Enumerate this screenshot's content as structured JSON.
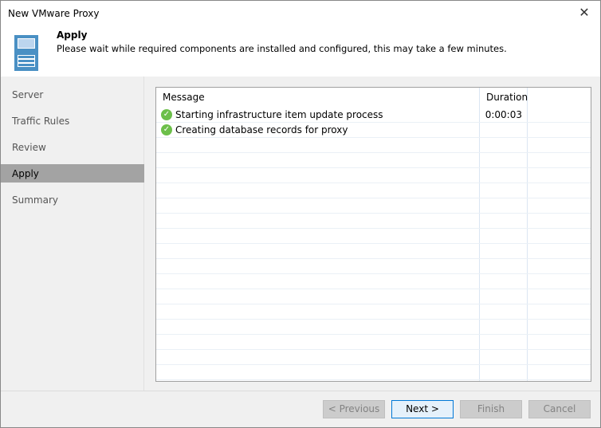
{
  "window": {
    "title": "New VMware Proxy"
  },
  "header": {
    "title": "Apply",
    "description": "Please wait while required components are installed and configured, this may take a few minutes."
  },
  "sidebar": {
    "items": [
      {
        "label": "Server"
      },
      {
        "label": "Traffic Rules"
      },
      {
        "label": "Review"
      },
      {
        "label": "Apply",
        "selected": true
      },
      {
        "label": "Summary"
      }
    ]
  },
  "table": {
    "columns": [
      "Message",
      "Duration"
    ],
    "rows": [
      {
        "status": "success",
        "message": "Starting infrastructure item update process",
        "duration": "0:00:03"
      },
      {
        "status": "success",
        "message": "Creating database records for proxy",
        "duration": ""
      }
    ]
  },
  "buttons": {
    "previous": "< Previous",
    "next": "Next >",
    "finish": "Finish",
    "cancel": "Cancel"
  },
  "colors": {
    "accent": "#0078d7",
    "success": "#6cbf4a",
    "selected": "#a3a3a3"
  }
}
